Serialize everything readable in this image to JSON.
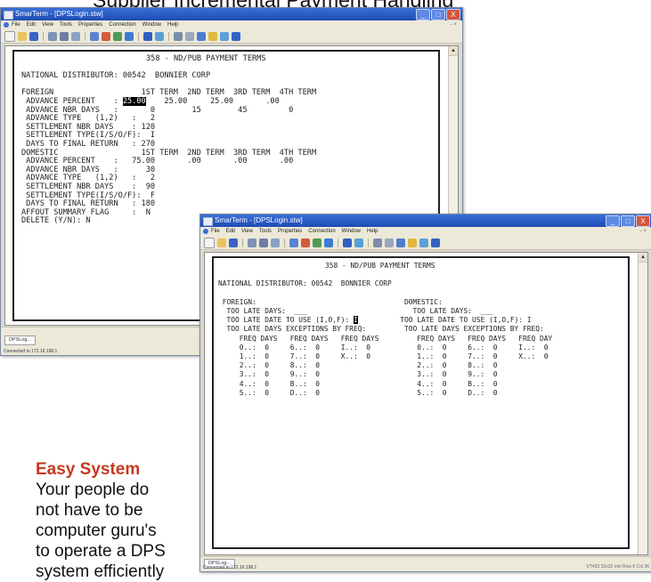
{
  "slide": {
    "title": "Supplier Incremental Payment Handling",
    "caption_heading": "Easy System",
    "caption_lines": [
      "Your people do",
      "not have to be",
      "computer guru's",
      "to operate a DPS",
      "system efficiently"
    ]
  },
  "app": {
    "title": "SmarTerm - [DPSLogin.stw]",
    "menu": [
      "File",
      "Edit",
      "View",
      "Tools",
      "Properties",
      "Connection",
      "Window",
      "Help"
    ],
    "menu_right": "- ×",
    "window_buttons": {
      "minimize": "_",
      "maximize": "□",
      "close": "X"
    },
    "taskbar_item": "DPSLog...",
    "connected": "Connected to 172.16.198.1"
  },
  "screen1": {
    "title": "358 - ND/PUB PAYMENT TERMS",
    "distributor": "NATIONAL DISTRIBUTOR: 00542  BONNIER CORP",
    "foreign_header": "FOREIGN                   1ST TERM  2ND TERM  3RD TERM  4TH TERM",
    "adv_pct_label": " ADVANCE PERCENT    : ",
    "adv_pct_value": "25.00",
    "adv_pct_rest": "    25.00     25.00       .00",
    "lines_a": [
      " ADVANCE NBR DAYS   :       0        15        45         0",
      " ADVANCE TYPE   (1,2)   :   2",
      " SETTLEMENT NBR DAYS    : 120",
      " SETTLEMENT TYPE(I/S/O/F):  I",
      " DAYS TO FINAL RETURN   : 270",
      "DOMESTIC                  1ST TERM  2ND TERM  3RD TERM  4TH TERM",
      " ADVANCE PERCENT    :   75.00       .00       .00       .00",
      " ADVANCE NBR DAYS   :      30",
      " ADVANCE TYPE   (1,2)   :   2",
      " SETTLEMENT NBR DAYS    :  90",
      " SETTLEMENT TYPE(I/S/O/F):  F",
      " DAYS TO FINAL RETURN   : 180",
      "",
      "AFFOUT SUMMARY FLAG     :  N",
      "DELETE (Y/N): N"
    ]
  },
  "screen2": {
    "title": "358 - ND/PUB PAYMENT TERMS",
    "distributor": "NATIONAL DISTRIBUTOR: 00542  BONNIER CORP",
    "section_headers": " FOREIGN:                                   DOMESTIC:",
    "late_days": "  TOO LATE DAYS:  ___                         TOO LATE DAYS:  ___",
    "late_date_label": "  TOO LATE DATE TO USE (I,O,F): ",
    "late_date_value": "I",
    "late_date_rest": "          TOO LATE DATE TO USE (I,O,F): I",
    "lines_b": [
      "  TOO LATE DAYS EXCEPTIONS BY FREQ:         TOO LATE DAYS EXCEPTIONS BY FREQ:",
      "     FREQ DAYS   FREQ DAYS   FREQ DAYS         FREQ DAYS   FREQ DAYS   FREQ DAY",
      "     0..:  0     6..:  0     I..:  0           0..:  0     6..:  0     I..:  0",
      "     1..:  0     7..:  0     X..:  0           1..:  0     7..:  0     X..:  0",
      "     2..:  0     8..:  0                       2..:  0     8..:  0",
      "     3..:  0     9..:  0                       3..:  0     9..:  0",
      "     4..:  0     B..:  0                       4..:  0     B..:  0",
      "     5..:  0     D..:  0                       5..:  0     D..:  0"
    ],
    "status_right": "VT420   33x32 min   Row 6   Col 36"
  },
  "colors": {
    "caption_heading": "#c5391e",
    "titlebar": "#1d4bb3"
  }
}
